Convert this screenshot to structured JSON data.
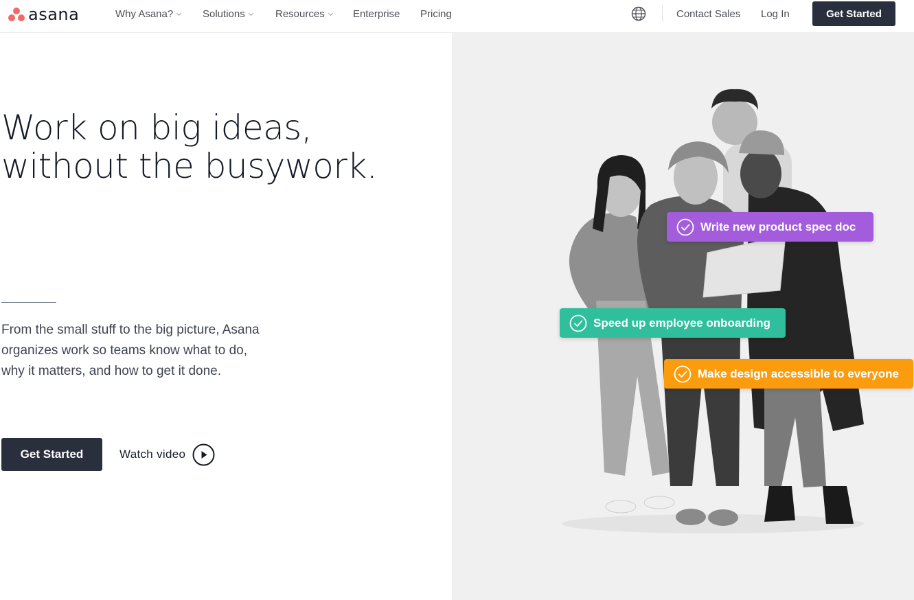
{
  "nav": {
    "logo_text": "asana",
    "logo_color": "#f06a6a",
    "items": [
      {
        "label": "Why Asana?",
        "has_dropdown": true
      },
      {
        "label": "Solutions",
        "has_dropdown": true
      },
      {
        "label": "Resources",
        "has_dropdown": true
      },
      {
        "label": "Enterprise",
        "has_dropdown": false
      },
      {
        "label": "Pricing",
        "has_dropdown": false
      }
    ],
    "language_icon": "globe-icon",
    "contact_sales": "Contact Sales",
    "log_in": "Log In",
    "get_started": "Get Started"
  },
  "hero": {
    "headline_line1": "Work on big ideas,",
    "headline_line2": "without the busywork.",
    "subcopy_line1": "From the small stuff to the big picture, Asana",
    "subcopy_line2": "organizes work so teams know what to do,",
    "subcopy_line3": "why it matters, and how to get it done.",
    "cta_label": "Get Started",
    "watch_video_label": "Watch video",
    "watch_video_icon": "play-circle-icon",
    "tasks": [
      {
        "label": "Write new product spec doc",
        "color": "#a35cdb",
        "icon": "check-circle-icon"
      },
      {
        "label": "Speed up employee onboarding",
        "color": "#2fbf9d",
        "icon": "check-circle-icon"
      },
      {
        "label": "Make design accessible to everyone",
        "color": "#fb9c0e",
        "icon": "check-circle-icon"
      }
    ]
  },
  "colors": {
    "dark_button": "#2a2f3d",
    "hero_right_bg": "#f0f0f0"
  }
}
